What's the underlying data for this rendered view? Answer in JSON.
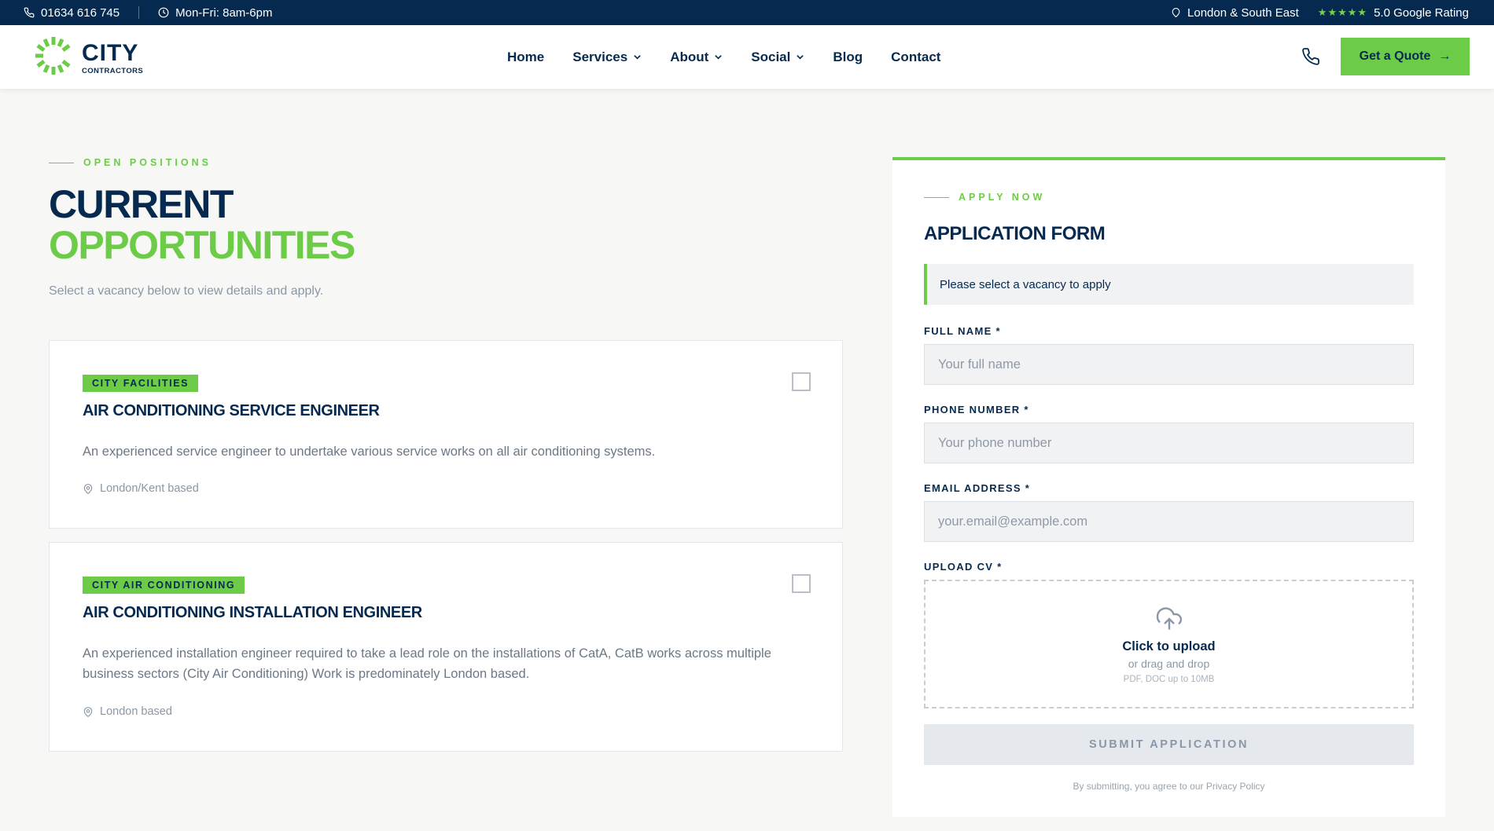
{
  "topbar": {
    "phone": "01634 616 745",
    "hours": "Mon-Fri: 8am-6pm",
    "location": "London & South East",
    "stars": "★★★★★",
    "rating": "5.0 Google Rating"
  },
  "header": {
    "logo_city": "CITY",
    "logo_sub": "CONTRACTORS",
    "nav": {
      "home": "Home",
      "services": "Services",
      "about": "About",
      "social": "Social",
      "blog": "Blog",
      "contact": "Contact"
    },
    "quote_label": "Get a Quote",
    "quote_arrow": "→"
  },
  "main": {
    "eyebrow": "OPEN POSITIONS",
    "title_line1": "CURRENT",
    "title_line2": "OPPORTUNITIES",
    "subtitle": "Select a vacancy below to view details and apply.",
    "jobs": [
      {
        "tag": "CITY FACILITIES",
        "title": "AIR CONDITIONING SERVICE ENGINEER",
        "description": "An experienced service engineer to undertake various service works on all air conditioning systems.",
        "location": "London/Kent based"
      },
      {
        "tag": "CITY AIR CONDITIONING",
        "title": "AIR CONDITIONING INSTALLATION ENGINEER",
        "description": "An experienced installation engineer required to take a lead role on the installations of CatA, CatB works across multiple business sectors (City Air Conditioning) Work is predominately London based.",
        "location": "London based"
      }
    ]
  },
  "form": {
    "eyebrow": "APPLY NOW",
    "title": "APPLICATION FORM",
    "notice": "Please select a vacancy to apply",
    "full_name_label": "FULL NAME *",
    "full_name_placeholder": "Your full name",
    "phone_label": "PHONE NUMBER *",
    "phone_placeholder": "Your phone number",
    "email_label": "EMAIL ADDRESS *",
    "email_placeholder": "your.email@example.com",
    "cv_label": "UPLOAD CV *",
    "upload_title": "Click to upload",
    "upload_sub": "or drag and drop",
    "upload_hint": "PDF, DOC up to 10MB",
    "submit_label": "SUBMIT APPLICATION",
    "consent": "By submitting, you agree to our Privacy Policy"
  },
  "colors": {
    "navy": "#062a4f",
    "green": "#6ccc47",
    "background": "#f7f7f5"
  },
  "icons": {
    "topbar_phone": "phone-icon",
    "topbar_hours": "clock-icon",
    "topbar_location": "map-pin-icon",
    "header_phone": "phone-icon",
    "upload": "cloud-upload-icon",
    "job_location": "map-pin-icon"
  }
}
